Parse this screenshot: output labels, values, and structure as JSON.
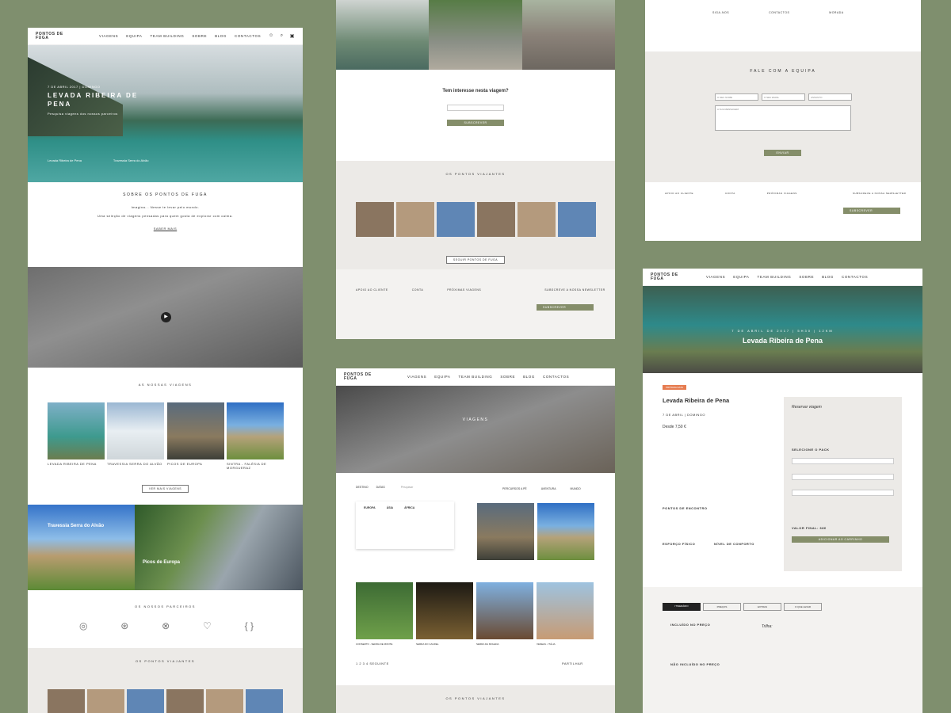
{
  "logo": "PONTOS DE FUGA",
  "nav": [
    "VIAGENS",
    "EQUIPA",
    "TEAM BUILDING",
    "SOBRE",
    "BLOG",
    "CONTACTOS"
  ],
  "hero": {
    "date": "7 DE ABRIL 2017 | DOMINGO",
    "title": "LEVADA RIBEIRA DE PENA",
    "sub": "Pesquisa viagens dos nossos parceiros",
    "link1": "Levada Ribeira de Pena",
    "link2": "Travessia Serra do Alvão"
  },
  "about": {
    "title": "SOBRE OS PONTOS DE FUGA",
    "lead": "Imagina... Nesse te levar pelo mundo.",
    "body": "Uma seleção de viagens pensadas para quem gosta de explorar com calma.",
    "btn": "SABER MAIS"
  },
  "trips": {
    "title": "AS NOSSAS VIAGENS",
    "items": [
      "LEVADA RIBEIRA DE PENA",
      "TRAVESSIA SERRA DO ALVÃO",
      "PICOS DE EUROPA",
      "SINTRA - FALÉSIA DE MORGUERAZ"
    ],
    "btn": "VER MAIS VIAGENS"
  },
  "featured": {
    "left": "Travessia Serra do Alvão",
    "right": "Picos de Europa"
  },
  "partners": {
    "title": "OS NOSSOS PARCEIROS"
  },
  "travelers": {
    "title": "OS PONTOS VIAJANTES",
    "btn": "SEGUIR PONTOS DE FUGA"
  },
  "interest": {
    "title": "Tem interesse nesta viagem?",
    "btn": "SUBSCREVER"
  },
  "footer": {
    "cols": [
      "APOIO AO CLIENTE",
      "CONTA",
      "PRÓXIMAS VIAGENS",
      "SUBSCREVE A NOSSA NEWSLETTER"
    ],
    "btn": "SUBSCREVER"
  },
  "contact": {
    "title": "FALE COM A EQUIPA",
    "fields": [
      "O SEU NOME",
      "O SEU EMAIL",
      "ASSUNTO",
      "A SUA MENSAGEM"
    ],
    "btn": "ENVIAR",
    "top": [
      "SIGA-NOS",
      "CONTACTOS",
      "MORADA"
    ]
  },
  "viagens": {
    "title": "VIAGENS",
    "filters": [
      "DESTINO",
      "DATAS"
    ],
    "search": "Pesquisar",
    "regions": [
      "EUROPA",
      "ÁSIA",
      "ÁFRICA"
    ],
    "cats": [
      "PERCURSOS A PÉ",
      "AVENTURA",
      "MUNDO"
    ],
    "row2": [
      "CONSERTO - SERRA DE MONTE",
      "SERRA DO CAUREL",
      "SERRA DA MOLEDA",
      "VENEZA - ITÁLIA"
    ],
    "pager": "1 2 3 4 SEGUINTE",
    "share": "PARTILHAR"
  },
  "detail": {
    "banner": "7 DE ABRIL DE 2017 | 5H30 | 12KM",
    "title": "Levada Ribeira de Pena",
    "tag": "PRÓXIMA DATA",
    "date": "7 DE ABRIL | DOMINGO",
    "price": "Desde 7,50 €",
    "reserve": "Reservar viagem",
    "packLabel": "SELECIONE O PACK",
    "total": "VALOR FINAL: 68€",
    "addBtn": "ADICIONAR AO CARRINHO",
    "tabs": [
      "ITINERÁRIO",
      "PREÇOS",
      "EXTRAS",
      "O QUE LEVAR"
    ],
    "incl": "INCLUÍDO NO PREÇO",
    "notincl": "NÃO INCLUÍDO NO PREÇO",
    "trilha": "Trilha:",
    "effort": "ESFORÇO FÍSICO",
    "comfort": "NÍVEL DE CONFORTO",
    "points": "PONTOS DE ENCONTRO"
  }
}
